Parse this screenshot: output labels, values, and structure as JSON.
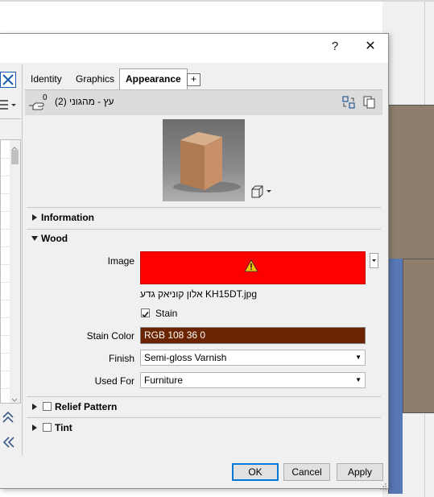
{
  "window": {
    "help_glyph": "?",
    "close_glyph": "✕"
  },
  "tabs": [
    {
      "label": "Identity"
    },
    {
      "label": "Graphics"
    },
    {
      "label": "Appearance"
    }
  ],
  "tab_add_glyph": "+",
  "asset": {
    "name": "עץ - מהגוני (2)",
    "count": "0"
  },
  "sections": {
    "information": "Information",
    "wood": "Wood",
    "relief": "Relief Pattern",
    "tint": "Tint"
  },
  "wood": {
    "image_label": "Image",
    "image_filename": "אלון קוניאק גדע KH15DT.jpg",
    "stain_checkbox": "Stain",
    "stain_checked": true,
    "stain_color_label": "Stain Color",
    "stain_color_value": "RGB 108 36 0",
    "finish_label": "Finish",
    "finish_value": "Semi-gloss Varnish",
    "used_for_label": "Used For",
    "used_for_value": "Furniture"
  },
  "buttons": {
    "ok": "OK",
    "cancel": "Cancel",
    "apply": "Apply"
  },
  "colors": {
    "image_error_bg": "#ff0000",
    "stain_swatch": "#6c2400",
    "warning": "#f5c400"
  },
  "icons": [
    "warning-icon",
    "hand-icon",
    "replace-icon",
    "duplicate-icon",
    "cube-icon",
    "close-icon",
    "collapse-icon"
  ]
}
